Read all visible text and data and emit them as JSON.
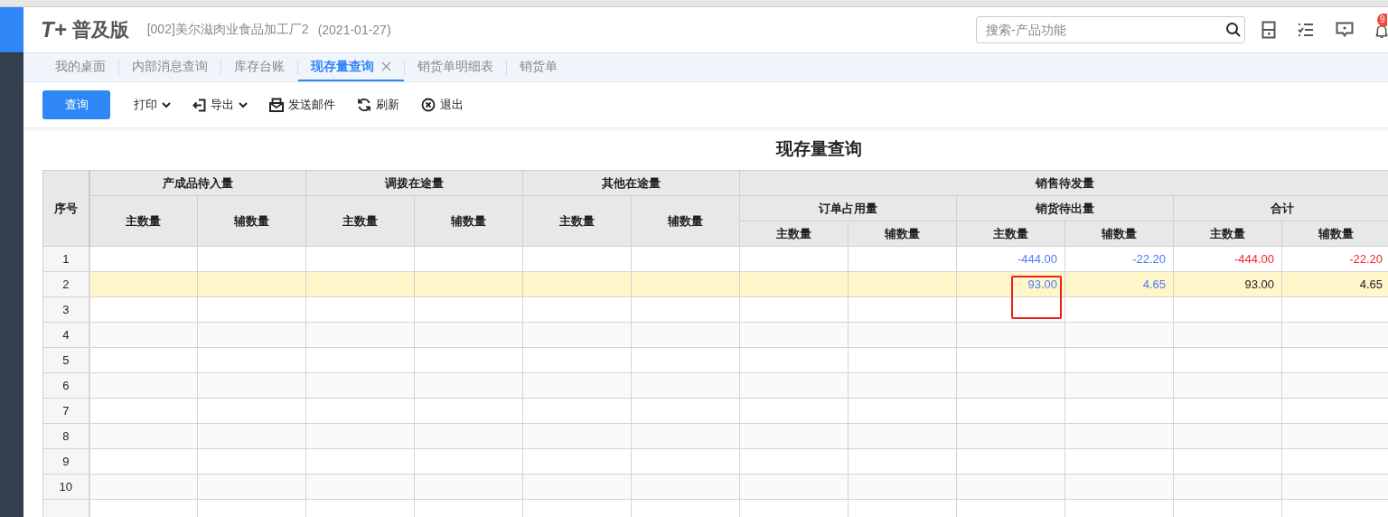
{
  "header": {
    "logo_mark": "T+",
    "product": "普及版",
    "company": "[002]美尔滋肉业食品加工厂2",
    "date": "(2021-01-27)",
    "search": {
      "placeholder": "搜索-产品功能"
    },
    "notification_badge": "9"
  },
  "tabs": [
    {
      "label": "我的桌面",
      "selected": false,
      "closable": false
    },
    {
      "label": "内部消息查询",
      "selected": false,
      "closable": false
    },
    {
      "label": "库存台账",
      "selected": false,
      "closable": false
    },
    {
      "label": "现存量查询",
      "selected": true,
      "closable": true
    },
    {
      "label": "销货单明细表",
      "selected": false,
      "closable": false
    },
    {
      "label": "销货单",
      "selected": false,
      "closable": false
    }
  ],
  "toolbar": [
    {
      "label": "查询",
      "kind": "primary"
    },
    {
      "label": "打印",
      "kind": "dropdown"
    },
    {
      "label": "导出",
      "kind": "export"
    },
    {
      "label": "发送邮件",
      "kind": "mail"
    },
    {
      "label": "刷新",
      "kind": "refresh"
    },
    {
      "label": "退出",
      "kind": "exit"
    }
  ],
  "report_title": "现存量查询",
  "table": {
    "index_header": "序号",
    "columns": [
      {
        "label": "产成品待入量",
        "children": [
          {
            "label": "主数量"
          },
          {
            "label": "辅数量"
          }
        ]
      },
      {
        "label": "调拨在途量",
        "children": [
          {
            "label": "主数量"
          },
          {
            "label": "辅数量"
          }
        ]
      },
      {
        "label": "其他在途量",
        "children": [
          {
            "label": "主数量"
          },
          {
            "label": "辅数量"
          }
        ]
      },
      {
        "label": "销售待发量",
        "children": [
          {
            "label": "订单占用量",
            "children": [
              {
                "label": "主数量"
              },
              {
                "label": "辅数量"
              }
            ]
          },
          {
            "label": "销货待出量",
            "children": [
              {
                "label": "主数量"
              },
              {
                "label": "辅数量"
              }
            ]
          },
          {
            "label": "合计",
            "children": [
              {
                "label": "主数量"
              },
              {
                "label": "辅数量"
              }
            ]
          }
        ]
      }
    ],
    "rows": [
      {
        "index": "1",
        "selected": false,
        "values": [
          {
            "text": "-444.00",
            "color": "#4a7cf6",
            "marked": false
          },
          {
            "text": "-22.20",
            "color": "#4a7cf6",
            "marked": false
          },
          {
            "text": "-444.00",
            "color": "#f5222d",
            "marked": false
          },
          {
            "text": "-22.20",
            "color": "#f5222d",
            "marked": false
          }
        ]
      },
      {
        "index": "2",
        "selected": true,
        "values": [
          {
            "text": "93.00",
            "color": "#4a7cf6",
            "marked": true
          },
          {
            "text": "4.65",
            "color": "#4a7cf6",
            "marked": false
          },
          {
            "text": "93.00",
            "color": "#222222",
            "marked": false
          },
          {
            "text": "4.65",
            "color": "#222222",
            "marked": false
          }
        ]
      },
      {
        "index": "3",
        "selected": false
      },
      {
        "index": "4",
        "selected": false
      },
      {
        "index": "5",
        "selected": false
      },
      {
        "index": "6",
        "selected": false
      },
      {
        "index": "7",
        "selected": false
      },
      {
        "index": "8",
        "selected": false
      },
      {
        "index": "9",
        "selected": false
      },
      {
        "index": "10",
        "selected": false
      },
      {
        "selected": false
      }
    ]
  }
}
